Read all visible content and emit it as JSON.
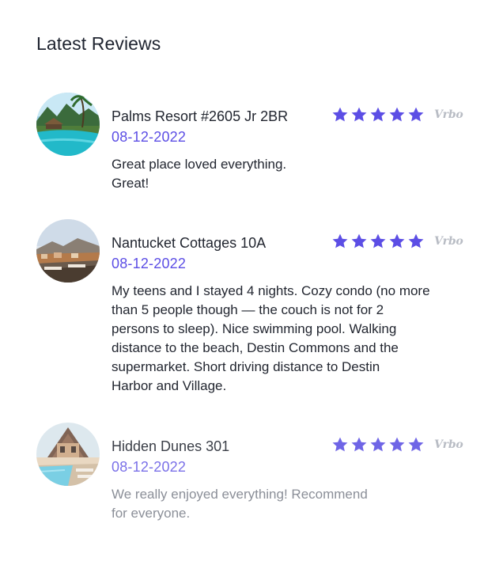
{
  "header": {
    "title": "Latest Reviews"
  },
  "colors": {
    "accent": "#5c4ee5",
    "text": "#222630",
    "muted": "#8b8f98",
    "source": "#b8bcc4"
  },
  "reviews": [
    {
      "property": "Palms Resort #2605 Jr 2BR",
      "date": "08-12-2022",
      "rating": 5,
      "source": "Vrbo",
      "text_lines": [
        "Great place loved everything.",
        "Great!"
      ],
      "avatar_icon": "resort-pool-photo"
    },
    {
      "property": "Nantucket Cottages 10A",
      "date": "08-12-2022",
      "rating": 5,
      "source": "Vrbo",
      "text_lines": [
        "My teens and I stayed 4 nights. Cozy condo (no more",
        "than 5 people though — the couch is not for 2",
        "persons to sleep). Nice swimming pool. Walking",
        "distance to the beach, Destin Commons and the",
        "supermarket. Short driving distance to Destin",
        "Harbor and Village."
      ],
      "avatar_icon": "rooftop-terrace-photo"
    },
    {
      "property": "Hidden Dunes 301",
      "date": "08-12-2022",
      "rating": 5,
      "source": "Vrbo",
      "text_lines": [
        "We really enjoyed everything! Recommend",
        "for everyone."
      ],
      "avatar_icon": "house-pool-photo"
    }
  ]
}
